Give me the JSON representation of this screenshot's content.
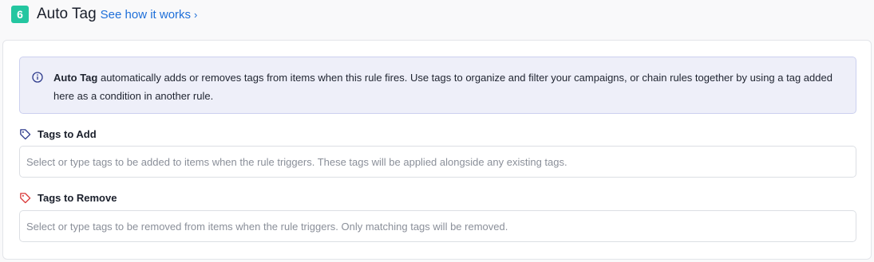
{
  "header": {
    "step_number": "6",
    "title": "Auto Tag",
    "link_label": "See how it works",
    "link_chevron": "›"
  },
  "info_box": {
    "bold_text": "Auto Tag",
    "text": " automatically adds or removes tags from items when this rule fires. Use tags to organize and filter your campaigns, or chain rules together by using a tag added here as a condition in another rule.",
    "icon": "info-circle-icon"
  },
  "tags_to_add": {
    "label": "Tags to Add",
    "icon": "tag-icon",
    "icon_color": "#2d3a8c",
    "value": "",
    "placeholder": "Select or type tags to be added to items when the rule triggers. These tags will be applied alongside any existing tags."
  },
  "tags_to_remove": {
    "label": "Tags to Remove",
    "icon": "tag-remove-icon",
    "icon_color": "#d93636",
    "value": "",
    "placeholder": "Select or type tags to be removed from items when the rule triggers. Only matching tags will be removed."
  },
  "colors": {
    "step_badge": "#24c6a0",
    "link": "#1e6fd9",
    "info_bg": "#eeeff9",
    "info_border": "#ccd0ef"
  }
}
